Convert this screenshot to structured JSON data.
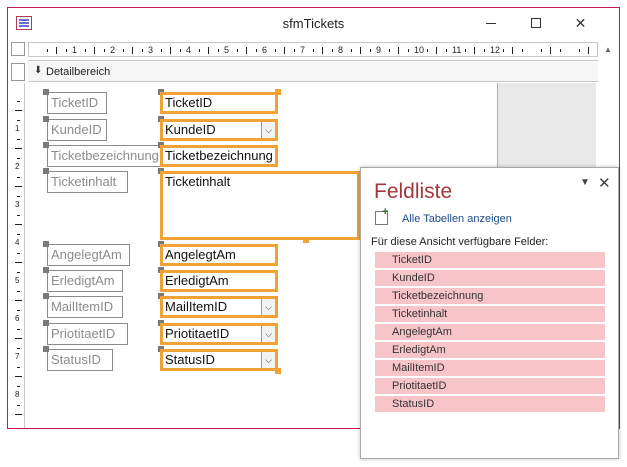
{
  "window": {
    "title": "sfmTickets"
  },
  "section": {
    "label": "Detailbereich"
  },
  "ruler": {
    "h_numbers": [
      "1",
      "2",
      "3",
      "4",
      "5",
      "6",
      "7",
      "8",
      "9",
      "10",
      "11",
      "12"
    ],
    "v_numbers": [
      "1",
      "2",
      "3",
      "4",
      "5",
      "6",
      "7",
      "8"
    ]
  },
  "form": {
    "labels": [
      "TicketID",
      "KundeID",
      "Ticketbezeichnung",
      "Ticketinhalt",
      "AngelegtAm",
      "ErledigtAm",
      "MailItemID",
      "PriotitaetID",
      "StatusID"
    ],
    "controls": [
      "TicketID",
      "KundeID",
      "Ticketbezeichnung",
      "Ticketinhalt",
      "AngelegtAm",
      "ErledigtAm",
      "MailItemID",
      "PriotitaetID",
      "StatusID"
    ]
  },
  "panel": {
    "title": "Feldliste",
    "link": "Alle Tabellen anzeigen",
    "subhead": "Für diese Ansicht verfügbare Felder:",
    "fields": [
      "TicketID",
      "KundeID",
      "Ticketbezeichnung",
      "Ticketinhalt",
      "AngelegtAm",
      "ErledigtAm",
      "MailItemID",
      "PriotitaetID",
      "StatusID"
    ]
  },
  "icons": {
    "app": "form-icon",
    "minimize": "minimize-icon",
    "maximize": "maximize-icon",
    "close": "close-icon",
    "dropdown": "chevron-down-icon",
    "add_table": "add-table-icon"
  },
  "colors": {
    "accent": "#c2185b",
    "selection": "#f0a234",
    "panel_title": "#a4373a",
    "field_bg": "#f7c4c8",
    "link": "#1f4e8c"
  }
}
